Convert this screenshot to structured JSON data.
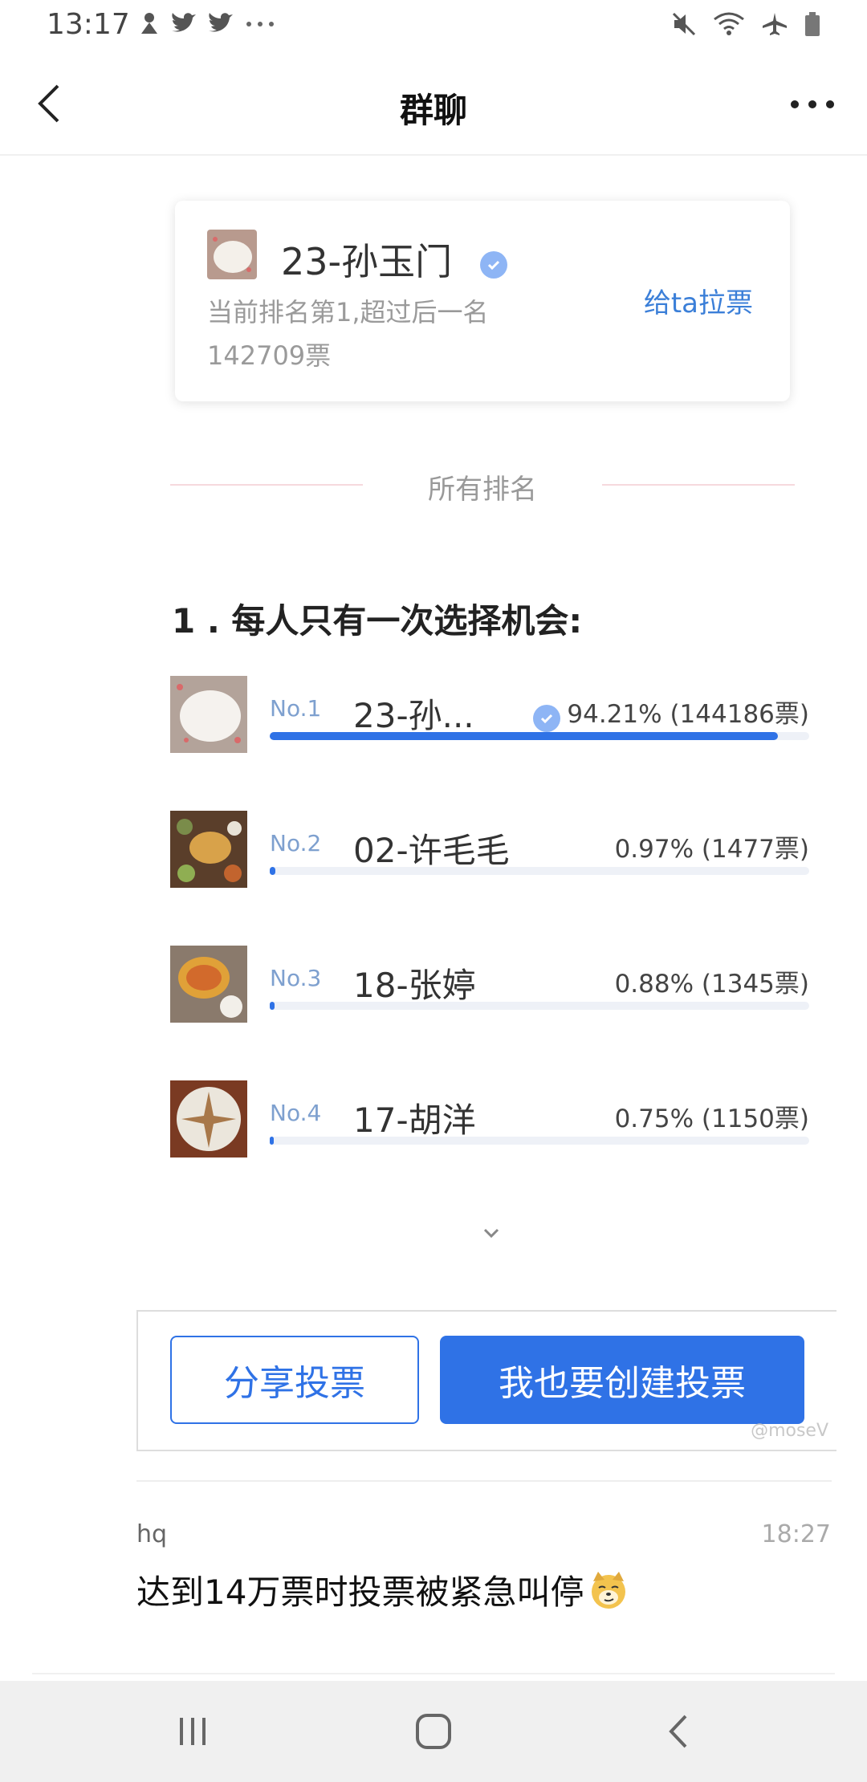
{
  "status_bar": {
    "time": "13:17",
    "left_icons": [
      "notification-icon",
      "twitter-icon",
      "twitter-icon",
      "more-dots-icon"
    ],
    "right_icons": [
      "mute-icon",
      "wifi-icon",
      "airplane-icon",
      "battery-icon"
    ]
  },
  "header": {
    "title": "群聊"
  },
  "featured": {
    "name": "23-孙玉门",
    "subtitle_line1": "当前排名第1,超过后一名",
    "subtitle_line2": "142709票",
    "vote_button": "给ta拉票"
  },
  "section_label": "所有排名",
  "question": "1 . 每人只有一次选择机会:",
  "rankings": [
    {
      "rank": "No.1",
      "name": "23-孙...",
      "percent_text": "94.21% (144186票)",
      "percent": 94.21,
      "verified": true
    },
    {
      "rank": "No.2",
      "name": "02-许毛毛",
      "percent_text": "0.97% (1477票)",
      "percent": 0.97,
      "verified": false
    },
    {
      "rank": "No.3",
      "name": "18-张婷",
      "percent_text": "0.88% (1345票)",
      "percent": 0.88,
      "verified": false
    },
    {
      "rank": "No.4",
      "name": "17-胡洋",
      "percent_text": "0.75% (1150票)",
      "percent": 0.75,
      "verified": false
    }
  ],
  "buttons": {
    "share": "分享投票",
    "create": "我也要创建投票"
  },
  "watermark": "@moseV",
  "message": {
    "sender": "hq",
    "time": "18:27",
    "text": "达到14万票时投票被紧急叫停"
  },
  "colors": {
    "accent": "#2f72e6",
    "link": "#3b7fd8",
    "rank_label": "#7ea0cf"
  }
}
